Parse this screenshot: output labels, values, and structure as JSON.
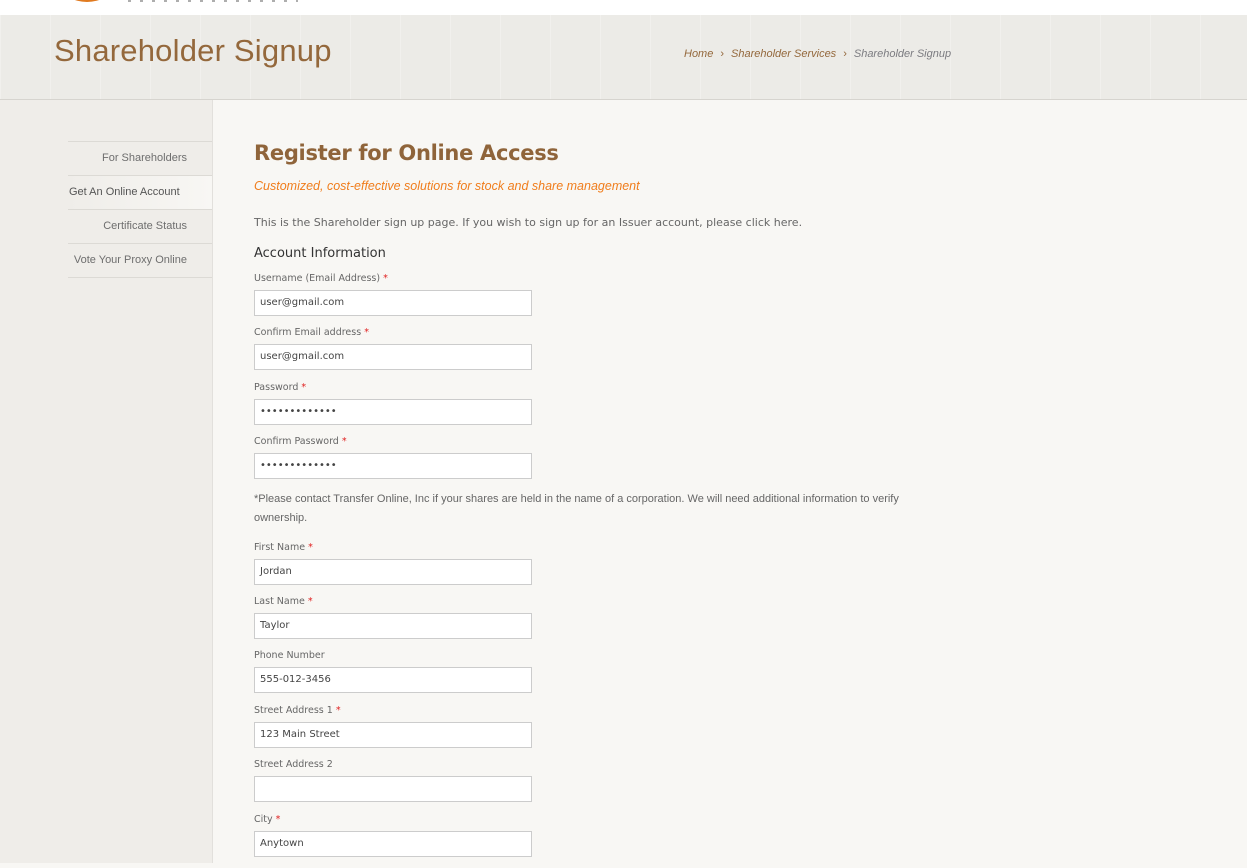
{
  "colors": {
    "accent": "#94683c",
    "subtitle": "#f07d1c",
    "required": "#e02020",
    "logo": "#e07a1f"
  },
  "header": {
    "title": "Shareholder Signup",
    "breadcrumb": [
      "Home",
      "Shareholder Services",
      "Shareholder Signup"
    ],
    "separator": "›"
  },
  "sidebar": {
    "items": [
      {
        "label": "For Shareholders"
      },
      {
        "label": "Get An Online Account",
        "active": true
      },
      {
        "label": "Certificate Status"
      },
      {
        "label": "Vote Your Proxy Online"
      }
    ]
  },
  "main": {
    "title": "Register for Online Access",
    "subtitle": "Customized, cost-effective solutions for stock and share management",
    "intro": "This is the Shareholder sign up page. If you wish to sign up for an Issuer account, please click ",
    "intro_link": "here",
    "intro_end": ".",
    "section": "Account Information",
    "note": "*Please contact Transfer Online, Inc if your shares are held in the name of a corporation. We will need additional information to verify ownership.",
    "required_mark": "*",
    "fields": [
      {
        "label": "Username (Email Address)",
        "value": "user@gmail.com",
        "required": true
      },
      {
        "label": "Confirm Email address",
        "value": "user@gmail.com",
        "required": true
      },
      {
        "label": "Password",
        "value": "•••••••••••••",
        "required": true
      },
      {
        "label": "Confirm Password",
        "value": "•••••••••••••",
        "required": true
      },
      {
        "label": "First Name",
        "value": "Jordan",
        "required": true
      },
      {
        "label": "Last Name",
        "value": "Taylor",
        "required": true
      },
      {
        "label": "Phone Number",
        "value": "555-012-3456",
        "required": false
      },
      {
        "label": "Street Address 1",
        "value": "123 Main Street",
        "required": true
      },
      {
        "label": "Street Address 2",
        "value": "",
        "required": false
      },
      {
        "label": "City",
        "value": "Anytown",
        "required": true
      }
    ]
  }
}
